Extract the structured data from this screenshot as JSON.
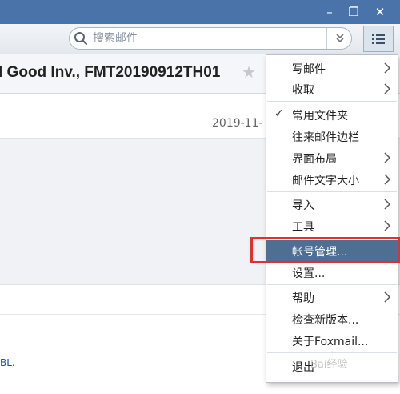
{
  "window": {
    "minimize_glyph": "–",
    "restore_glyph": "❐",
    "close_glyph": "✕"
  },
  "search": {
    "placeholder": "搜索邮件",
    "icon": "search-icon"
  },
  "toolbar": {
    "filter_icon": "chevron-double-down-icon",
    "menu_icon": "list-menu-icon"
  },
  "message": {
    "subject": "l Good Inv., FMT20190912TH01",
    "star_glyph": "★",
    "date": "2019-11-",
    "link_text": "BL."
  },
  "menu": {
    "items": [
      {
        "label": "写邮件",
        "submenu": true
      },
      {
        "label": "收取",
        "submenu": true
      },
      {
        "label": "常用文件夹",
        "checked": true
      },
      {
        "label": "往来邮件边栏"
      },
      {
        "label": "界面布局",
        "submenu": true
      },
      {
        "label": "邮件文字大小",
        "submenu": true
      },
      {
        "label": "导入",
        "submenu": true
      },
      {
        "label": "工具",
        "submenu": true
      },
      {
        "label": "帐号管理...",
        "highlighted": true
      },
      {
        "label": "设置..."
      },
      {
        "label": "帮助",
        "submenu": true
      },
      {
        "label": "检查新版本..."
      },
      {
        "label": "关于Foxmail..."
      },
      {
        "label": "退出"
      }
    ],
    "check_glyph": "✓"
  },
  "watermark": "Bai经验",
  "colors": {
    "titlebar": "#4a74a9",
    "highlight": "#4f6f92",
    "callout_border": "#e03030"
  }
}
